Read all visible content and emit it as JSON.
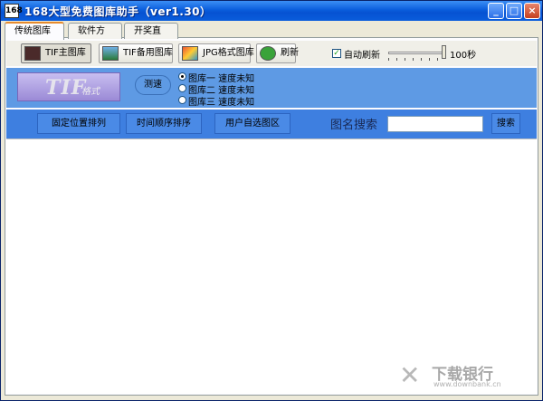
{
  "window": {
    "title": "168大型免费图库助手（ver1.30）",
    "app_icon_text": "168",
    "controls": {
      "minimize": "_",
      "maximize": "□",
      "close": "×"
    }
  },
  "tabs": [
    {
      "label": "传统图库",
      "active": true
    },
    {
      "label": "软件方式",
      "active": false
    },
    {
      "label": "开奖直播",
      "active": false
    }
  ],
  "toolbar": {
    "buttons": [
      {
        "label": "TIF主图库",
        "icon": "tif-main-icon"
      },
      {
        "label": "TIF备用图库",
        "icon": "tif-backup-icon"
      },
      {
        "label": "JPG格式图库",
        "icon": "jpg-gallery-icon"
      },
      {
        "label": "刷新",
        "icon": "refresh-icon"
      }
    ],
    "auto_refresh": {
      "label": "自动刷新",
      "checked": true
    },
    "interval": {
      "value": 100,
      "label": "100秒"
    }
  },
  "gallery_panel": {
    "logo_text": "TIF",
    "logo_sub": "格式",
    "speed_test_label": "测速",
    "servers": [
      {
        "label": "图库一 速度未知",
        "selected": true
      },
      {
        "label": "图库二 速度未知",
        "selected": false
      },
      {
        "label": "图库三 速度未知",
        "selected": false
      }
    ]
  },
  "sort_bar": {
    "buttons": [
      "固定位置排列",
      "时间顺序排序",
      "用户自选图区"
    ],
    "search_label": "图名搜索",
    "search_value": "",
    "search_button": "搜索"
  },
  "watermark": {
    "text": "下载银行",
    "url": "www.downbank.cn"
  },
  "colors": {
    "band_top": "#5e9ae4",
    "band_bottom": "#3e7fe0",
    "title_bar": "#0a5ddc"
  }
}
